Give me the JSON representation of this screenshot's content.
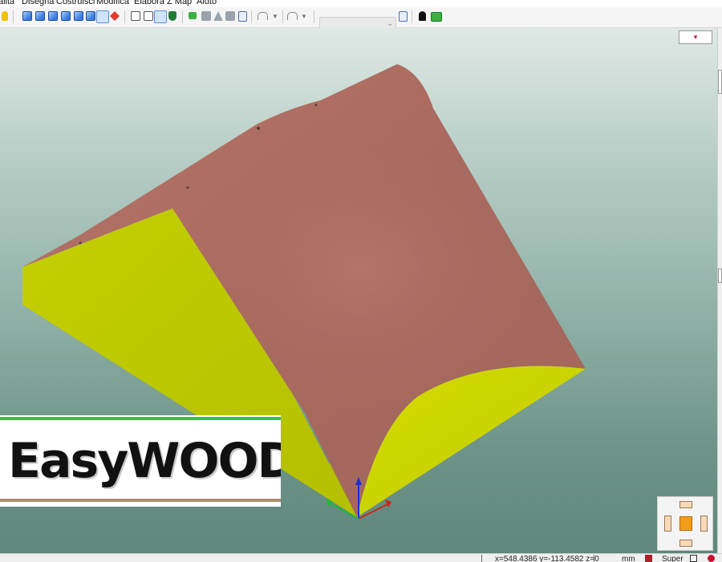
{
  "menu": [
    "alita",
    "Disegna",
    "Costruisci",
    "Modifica",
    "Elabora",
    "Z Map",
    "Aiuto"
  ],
  "toolbar": {
    "combo_value": "",
    "icons": [
      "bulb-icon",
      "view-iso-icon",
      "view-front-icon",
      "view-side-icon",
      "view-top-icon",
      "view-back-icon",
      "view-shaded-icon",
      "view-axes-icon",
      "wire-shade-icon",
      "outline-shade-icon",
      "solid-shade-icon",
      "shield-icon",
      "grid-snap-icon",
      "printer-icon",
      "draw-tool-icon",
      "cut-tool-icon",
      "document-icon",
      "undo-icon",
      "redo-icon",
      "user-icon",
      "layer-color-icon"
    ]
  },
  "viewport": {
    "view_menu_glyph": "▾",
    "part_colors": {
      "top_surface": "#a86a5f",
      "side_faces": "#bfcc00",
      "side_faces_dark": "#9aa300"
    }
  },
  "logo": {
    "text": "EasyWOOD"
  },
  "status": {
    "coords": "x=548.4386  y=-113.4582  z=0",
    "unit": "mm",
    "view": "Super"
  },
  "colors": {
    "accent_green": "#28c84a",
    "accent_brown": "#b08e6b",
    "navcube_center": "#f39c1a"
  }
}
